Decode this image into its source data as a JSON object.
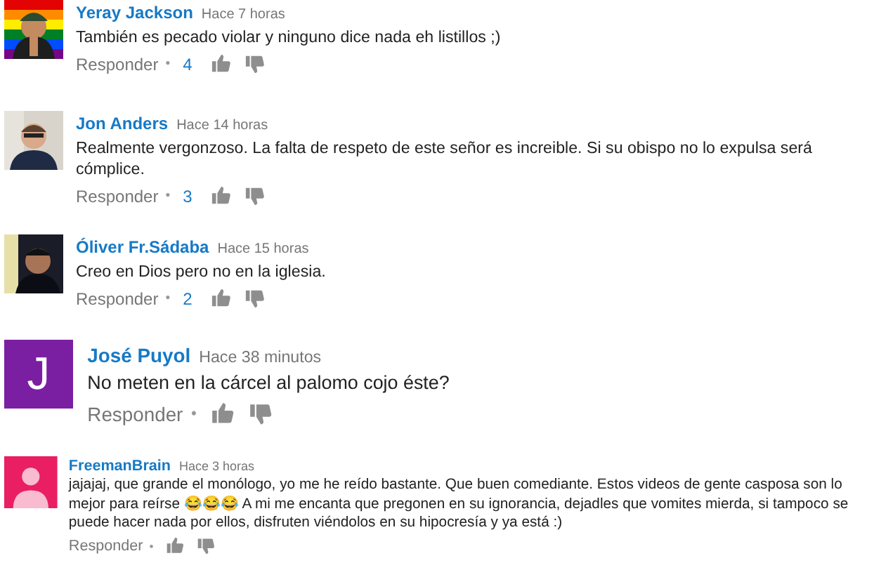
{
  "comments": [
    {
      "author": "Yeray Jackson",
      "time": "Hace 7 horas",
      "text": "También es pecado violar y ninguno dice nada eh listillos ;)",
      "reply": "Responder",
      "separator": "•",
      "likes": "4"
    },
    {
      "author": "Jon Anders",
      "time": "Hace 14 horas",
      "text": "Realmente vergonzoso. La falta de respeto de este señor es increible. Si su obispo no lo expulsa será cómplice.",
      "reply": "Responder",
      "separator": "•",
      "likes": "3"
    },
    {
      "author": "Óliver Fr.Sádaba",
      "time": "Hace 15 horas",
      "text": "Creo en Dios pero no en la iglesia.",
      "reply": "Responder",
      "separator": "•",
      "likes": "2"
    },
    {
      "author": "José Puyol",
      "time": "Hace 38 minutos",
      "text": "No meten en la cárcel al palomo cojo éste?",
      "avatar": {
        "kind": "letter",
        "letter": "J",
        "color": "#7b1fa2"
      },
      "reply": "Responder",
      "separator": "•"
    },
    {
      "author": "FreemanBrain",
      "time": "Hace 3 horas",
      "text": "jajajaj, que grande el monólogo, yo me he reído bastante. Que buen comediante. Estos videos de gente casposa son lo mejor para reírse 😂😂😂 A mi me encanta que pregonen en su ignorancia, dejadles que vomites mierda, si tampoco se puede hacer nada por ellos, disfruten viéndolos en su hipocresía y ya está :)",
      "avatar": {
        "kind": "default",
        "color": "#e91e63"
      },
      "reply": "Responder",
      "separator": "•"
    }
  ]
}
